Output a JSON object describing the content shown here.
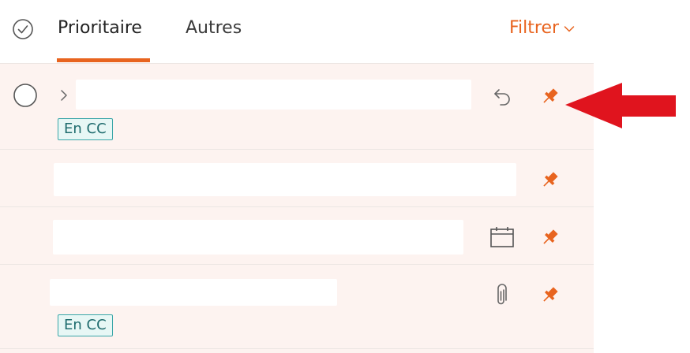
{
  "header": {
    "select_all_icon": "check-circle-icon",
    "tabs": [
      {
        "label": "Prioritaire",
        "active": true
      },
      {
        "label": "Autres",
        "active": false
      }
    ],
    "filter_label": "Filtrer",
    "filter_icon": "chevron-down-icon"
  },
  "messages": [
    {
      "tag": "En CC",
      "icons": [
        "reply-icon",
        "pin-icon"
      ],
      "pinned": true
    },
    {
      "tag": "",
      "icons": [
        "pin-icon"
      ],
      "pinned": true
    },
    {
      "tag": "",
      "icons": [
        "calendar-icon",
        "pin-icon"
      ],
      "pinned": true
    },
    {
      "tag": "En CC",
      "icons": [
        "paperclip-icon",
        "pin-icon"
      ],
      "pinned": true
    }
  ],
  "annotation": {
    "icon": "red-arrow-icon"
  },
  "colors": {
    "accent": "#e8641f",
    "row_background": "#fdf3f0",
    "tag_border": "#3aa6a8",
    "tag_background": "#e7f7f5",
    "arrow": "#e0141e"
  }
}
